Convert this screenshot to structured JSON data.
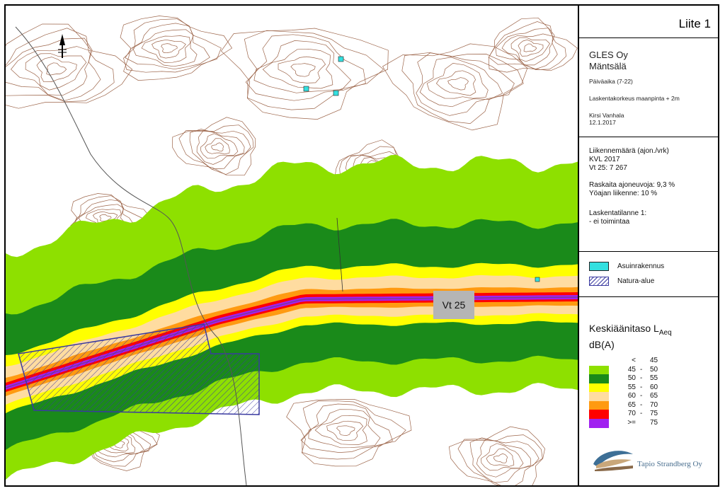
{
  "header": {
    "title": "Liite 1"
  },
  "info": {
    "company": "GLES Oy",
    "place": "Mäntsälä",
    "period": "Päiväaika (7-22)",
    "height": "Laskentakorkeus maanpinta + 2m",
    "author": "Kirsi Vanhala",
    "date": "12.1.2017"
  },
  "traffic": {
    "line1": "Liikennemäärä (ajon./vrk)",
    "line2": "KVL 2017",
    "line3": "Vt 25: 7 267",
    "line4": "Raskaita ajoneuvoja: 9,3 %",
    "line5": "Yöajan liikenne: 10 %",
    "line6": "Laskentatilanne 1:",
    "line7": " - ei toimintaa"
  },
  "legend_symbols": {
    "building": {
      "label": "Asuinrakennus",
      "color": "#33e0e0"
    },
    "natura": {
      "label": "Natura-alue",
      "color": "#3a3aa0"
    }
  },
  "noise_legend": {
    "title_main": "Keskiäänitaso L",
    "title_sub": "Aeq",
    "unit": "dB(A)",
    "bands": [
      {
        "a": "<",
        "b": "45",
        "color": "#ffffff"
      },
      {
        "a": "45",
        "b": "50",
        "color": "#8ee000"
      },
      {
        "a": "50",
        "b": "55",
        "color": "#1a8a1a"
      },
      {
        "a": "55",
        "b": "60",
        "color": "#ffff00"
      },
      {
        "a": "60",
        "b": "65",
        "color": "#ffdca0"
      },
      {
        "a": "65",
        "b": "70",
        "color": "#ff9a10"
      },
      {
        "a": "70",
        "b": "75",
        "color": "#ff0000"
      },
      {
        "a": ">=",
        "b": "75",
        "color": "#a020f0"
      }
    ]
  },
  "map": {
    "road_label": "Vt 25",
    "north_icon": "north-arrow-icon"
  },
  "logo": {
    "text": "Tapio Strandberg Oy"
  }
}
